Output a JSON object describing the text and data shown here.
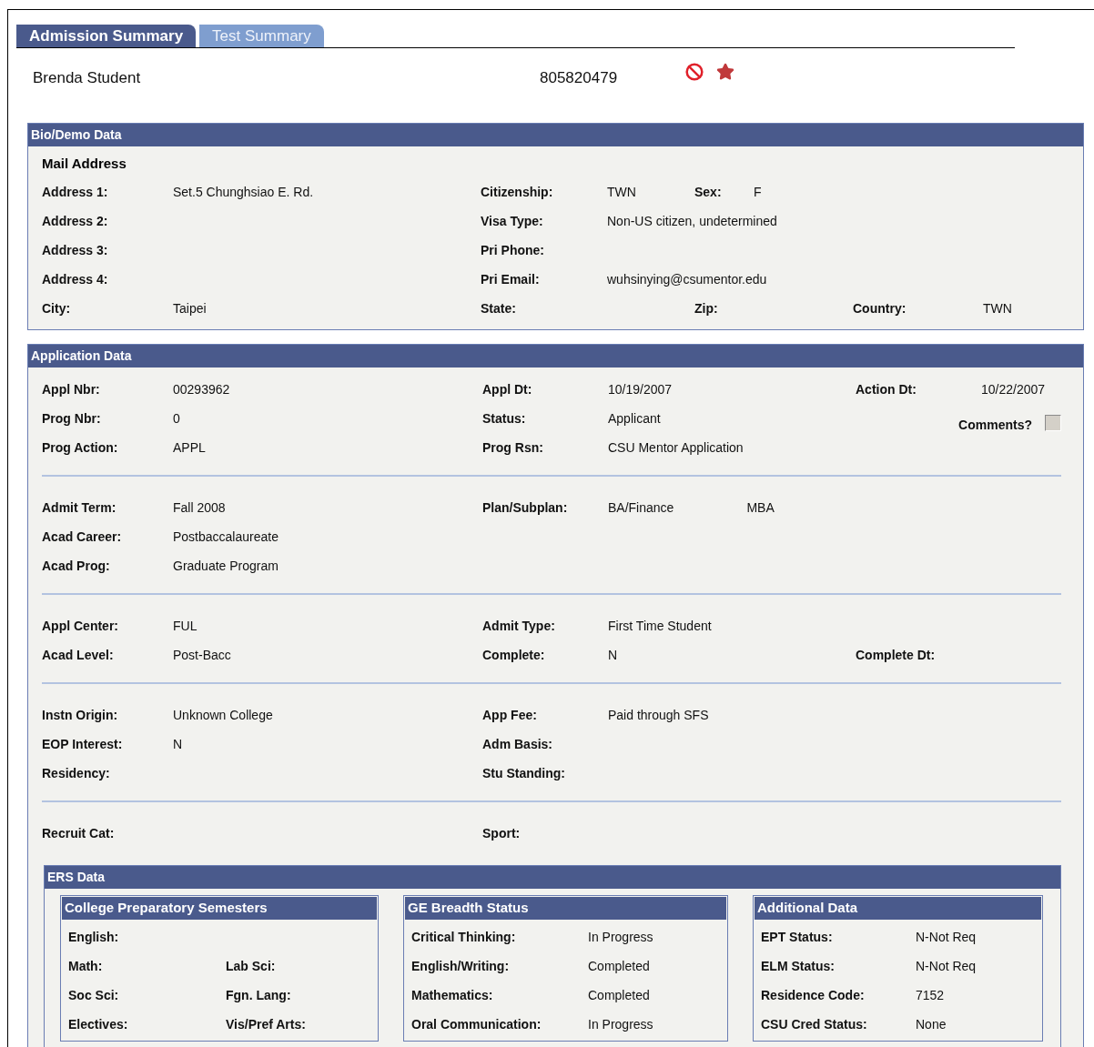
{
  "tabs": [
    {
      "label": "Admission Summary",
      "selected": true
    },
    {
      "label": "Test Summary",
      "selected": false
    }
  ],
  "student": {
    "name": "Brenda Student",
    "id": "805820479"
  },
  "bio_demo": {
    "title": "Bio/Demo Data",
    "heading": "Mail Address",
    "rows": [
      [
        {
          "label": "Address 1:",
          "value": "Set.5 Chunghsiao E. Rd."
        },
        {
          "label": "Citizenship:",
          "value": "TWN"
        },
        {
          "label": "Sex:",
          "value": "F"
        }
      ],
      [
        {
          "label": "Address 2:"
        },
        {
          "label": "Visa Type:",
          "value": "Non-US citizen, undetermined"
        }
      ],
      [
        {
          "label": "Address 3:"
        },
        {
          "label": "Pri Phone:"
        }
      ],
      [
        {
          "label": "Address 4:"
        },
        {
          "label": "Pri Email:",
          "value": "wuhsinying@csumentor.edu"
        }
      ],
      [
        {
          "label": "City:",
          "value": "Taipei"
        },
        {
          "label": "State:"
        },
        {
          "label": "Zip:"
        },
        {
          "label": "Country:",
          "value": "TWN"
        }
      ]
    ]
  },
  "application": {
    "title": "Application Data",
    "groups": [
      {
        "rows": [
          [
            {
              "kind": "pair",
              "label": "Appl Nbr:",
              "value": "00293962"
            },
            {
              "kind": "pair",
              "label": "Appl Dt:",
              "value": "10/19/2007"
            },
            {
              "kind": "pair",
              "label": "Action Dt:",
              "value": "10/22/2007"
            }
          ],
          [
            {
              "kind": "pair",
              "label": "Prog Nbr:",
              "value": "0"
            },
            {
              "kind": "pair",
              "label": "Status:",
              "value": "Applicant"
            },
            {
              "kind": "checkbox",
              "label": "Comments?",
              "checked": false
            }
          ],
          [
            {
              "kind": "pair",
              "label": "Prog Action:",
              "value": "APPL"
            },
            {
              "kind": "pair",
              "label": "Prog Rsn:",
              "value": "CSU Mentor Application"
            }
          ]
        ]
      },
      {
        "rows": [
          [
            {
              "kind": "pair",
              "label": "Admit Term:",
              "value": "Fall 2008"
            },
            {
              "kind": "pair",
              "label": "Plan/Subplan:",
              "value": "BA/Finance",
              "value_2": "MBA"
            }
          ],
          [
            {
              "kind": "pair",
              "label": "Acad Career:",
              "value": "Postbaccalaureate"
            }
          ],
          [
            {
              "kind": "pair",
              "label": "Acad Prog:",
              "value": "Graduate Program"
            }
          ]
        ]
      },
      {
        "rows": [
          [
            {
              "kind": "pair",
              "label": "Appl Center:",
              "value": "FUL"
            },
            {
              "kind": "pair",
              "label": "Admit Type:",
              "value": "First Time Student"
            }
          ],
          [
            {
              "kind": "pair",
              "label": "Acad Level:",
              "value": "Post-Bacc"
            },
            {
              "kind": "pair",
              "label": "Complete:",
              "value": "N"
            },
            {
              "kind": "pair",
              "label": "Complete Dt:"
            }
          ]
        ]
      },
      {
        "rows": [
          [
            {
              "kind": "pair",
              "label": "Instn Origin:",
              "value": "Unknown College"
            },
            {
              "kind": "pair",
              "label": "App Fee:",
              "value": "Paid through SFS"
            }
          ],
          [
            {
              "kind": "pair",
              "label": "EOP Interest:",
              "value": "N"
            },
            {
              "kind": "pair",
              "label": "Adm Basis:"
            }
          ],
          [
            {
              "kind": "pair",
              "label": "Residency:"
            },
            {
              "kind": "pair",
              "label": "Stu Standing:"
            }
          ]
        ]
      },
      {
        "rows": [
          [
            {
              "kind": "pair",
              "label": "Recruit Cat:"
            },
            {
              "kind": "pair",
              "label": "Sport:"
            }
          ]
        ]
      }
    ]
  },
  "ers": {
    "title": "ERS Data",
    "panels": [
      {
        "title": "College Preparatory Semesters",
        "rows": [
          [
            {
              "label": "English:"
            }
          ],
          [
            {
              "label": "Math:"
            },
            {
              "label": "Lab Sci:"
            }
          ],
          [
            {
              "label": "Soc Sci:"
            },
            {
              "label": "Fgn. Lang:"
            }
          ],
          [
            {
              "label": "Electives:"
            },
            {
              "label": "Vis/Pref Arts:"
            }
          ]
        ]
      },
      {
        "title": "GE Breadth Status",
        "rows": [
          [
            {
              "label": "Critical Thinking:",
              "value": "In Progress"
            }
          ],
          [
            {
              "label": "English/Writing:",
              "value": "Completed"
            }
          ],
          [
            {
              "label": "Mathematics:",
              "value": "Completed"
            }
          ],
          [
            {
              "label": "Oral Communication:",
              "value": "In Progress"
            }
          ]
        ]
      },
      {
        "title": "Additional Data",
        "rows": [
          [
            {
              "label": "EPT Status:",
              "value": "N-Not Req"
            }
          ],
          [
            {
              "label": "ELM Status:",
              "value": "N-Not Req"
            }
          ],
          [
            {
              "label": "Residence Code:",
              "value": "7152"
            }
          ],
          [
            {
              "label": "CSU Cred Status:",
              "value": "None"
            }
          ]
        ]
      }
    ]
  }
}
